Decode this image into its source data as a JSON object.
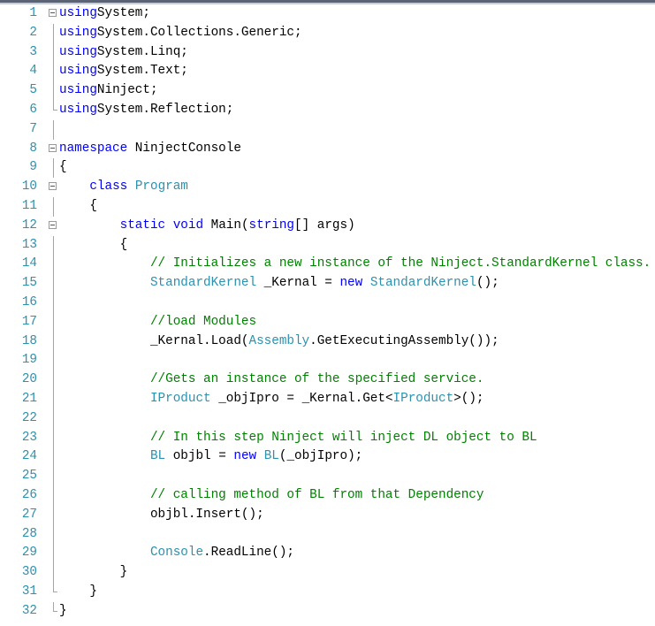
{
  "editor": {
    "colors": {
      "keyword": "#0000ff",
      "type": "#2b91af",
      "comment": "#008000",
      "line_number": "#2b91af"
    },
    "lines": [
      {
        "n": "1",
        "tokens": [
          [
            "kw",
            "using"
          ],
          [
            "",
            "System;"
          ]
        ]
      },
      {
        "n": "2",
        "tokens": [
          [
            "kw",
            "using"
          ],
          [
            "",
            "System.Collections.Generic;"
          ]
        ]
      },
      {
        "n": "3",
        "tokens": [
          [
            "kw",
            "using"
          ],
          [
            "",
            "System.Linq;"
          ]
        ]
      },
      {
        "n": "4",
        "tokens": [
          [
            "kw",
            "using"
          ],
          [
            "",
            "System.Text;"
          ]
        ]
      },
      {
        "n": "5",
        "tokens": [
          [
            "kw",
            "using"
          ],
          [
            "",
            "Ninject;"
          ]
        ]
      },
      {
        "n": "6",
        "tokens": [
          [
            "kw",
            "using"
          ],
          [
            "",
            "System.Reflection;"
          ]
        ]
      },
      {
        "n": "7",
        "tokens": []
      },
      {
        "n": "8",
        "tokens": [
          [
            "kw",
            "namespace"
          ],
          [
            "",
            " NinjectConsole"
          ]
        ]
      },
      {
        "n": "9",
        "tokens": [
          [
            "",
            "{"
          ]
        ]
      },
      {
        "n": "10",
        "tokens": [
          [
            "",
            "    "
          ],
          [
            "kw",
            "class"
          ],
          [
            "",
            " "
          ],
          [
            "ty",
            "Program"
          ]
        ]
      },
      {
        "n": "11",
        "tokens": [
          [
            "",
            "    {"
          ]
        ]
      },
      {
        "n": "12",
        "tokens": [
          [
            "",
            "        "
          ],
          [
            "kw",
            "static"
          ],
          [
            "",
            " "
          ],
          [
            "kw",
            "void"
          ],
          [
            "",
            " Main("
          ],
          [
            "kw",
            "string"
          ],
          [
            "",
            "[] args)"
          ]
        ]
      },
      {
        "n": "13",
        "tokens": [
          [
            "",
            "        {"
          ]
        ]
      },
      {
        "n": "14",
        "tokens": [
          [
            "",
            "            "
          ],
          [
            "cm",
            "// Initializes a new instance of the Ninject.StandardKernel class."
          ]
        ]
      },
      {
        "n": "15",
        "tokens": [
          [
            "",
            "            "
          ],
          [
            "ty",
            "StandardKernel"
          ],
          [
            "",
            " _Kernal = "
          ],
          [
            "kw",
            "new"
          ],
          [
            "",
            " "
          ],
          [
            "ty",
            "StandardKernel"
          ],
          [
            "",
            "();"
          ]
        ]
      },
      {
        "n": "16",
        "tokens": []
      },
      {
        "n": "17",
        "tokens": [
          [
            "",
            "            "
          ],
          [
            "cm",
            "//load Modules"
          ]
        ]
      },
      {
        "n": "18",
        "tokens": [
          [
            "",
            "            _Kernal.Load("
          ],
          [
            "ty",
            "Assembly"
          ],
          [
            "",
            ".GetExecutingAssembly());"
          ]
        ]
      },
      {
        "n": "19",
        "tokens": []
      },
      {
        "n": "20",
        "tokens": [
          [
            "",
            "            "
          ],
          [
            "cm",
            "//Gets an instance of the specified service."
          ]
        ]
      },
      {
        "n": "21",
        "tokens": [
          [
            "",
            "            "
          ],
          [
            "ty",
            "IProduct"
          ],
          [
            "",
            " _objIpro = _Kernal.Get<"
          ],
          [
            "ty",
            "IProduct"
          ],
          [
            "",
            ">();"
          ]
        ]
      },
      {
        "n": "22",
        "tokens": []
      },
      {
        "n": "23",
        "tokens": [
          [
            "",
            "            "
          ],
          [
            "cm",
            "// In this step Ninject will inject DL object to BL"
          ]
        ]
      },
      {
        "n": "24",
        "tokens": [
          [
            "",
            "            "
          ],
          [
            "ty",
            "BL"
          ],
          [
            "",
            " objbl = "
          ],
          [
            "kw",
            "new"
          ],
          [
            "",
            " "
          ],
          [
            "ty",
            "BL"
          ],
          [
            "",
            "(_objIpro);"
          ]
        ]
      },
      {
        "n": "25",
        "tokens": []
      },
      {
        "n": "26",
        "tokens": [
          [
            "",
            "            "
          ],
          [
            "cm",
            "// calling method of BL from that Dependency"
          ]
        ]
      },
      {
        "n": "27",
        "tokens": [
          [
            "",
            "            objbl.Insert();"
          ]
        ]
      },
      {
        "n": "28",
        "tokens": []
      },
      {
        "n": "29",
        "tokens": [
          [
            "",
            "            "
          ],
          [
            "ty",
            "Console"
          ],
          [
            "",
            ".ReadLine();"
          ]
        ]
      },
      {
        "n": "30",
        "tokens": [
          [
            "",
            "        }"
          ]
        ]
      },
      {
        "n": "31",
        "tokens": [
          [
            "",
            "    }"
          ]
        ]
      },
      {
        "n": "32",
        "tokens": [
          [
            "",
            "}"
          ]
        ]
      }
    ]
  }
}
